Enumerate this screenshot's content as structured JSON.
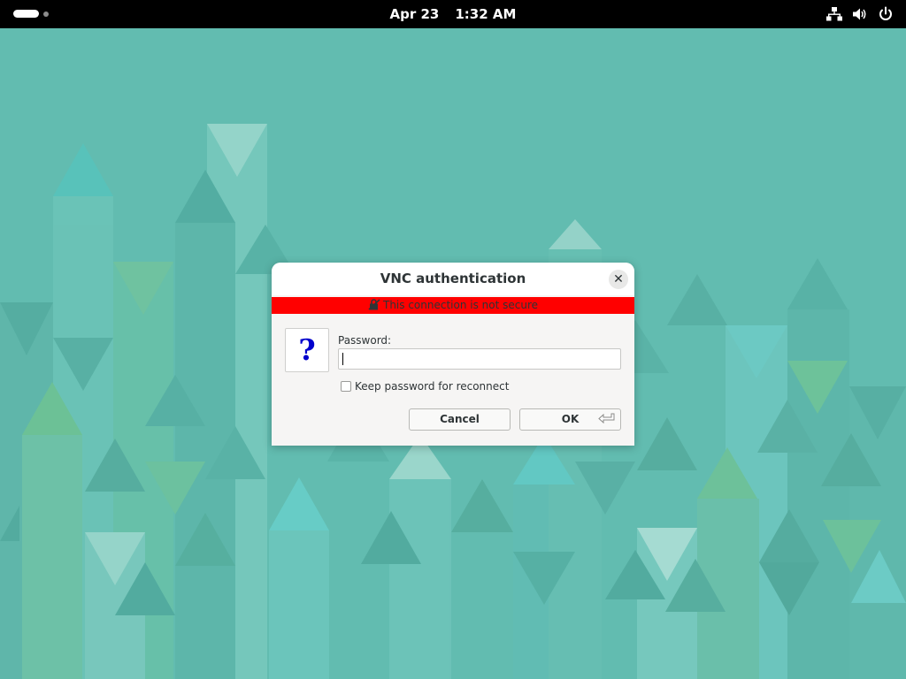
{
  "topbar": {
    "date": "Apr 23",
    "time": "1:32 AM",
    "icons": [
      "network-icon",
      "volume-icon",
      "power-icon"
    ]
  },
  "dialog": {
    "title": "VNC authentication",
    "close_label": "✕",
    "warning_text": "This connection is not secure",
    "question_glyph": "?",
    "password_label": "Password:",
    "password_value": "",
    "keep_password_label": "Keep password for reconnect",
    "keep_password_checked": false,
    "cancel_label": "Cancel",
    "ok_label": "OK"
  },
  "colors": {
    "wallpaper_base": "#62bcb0",
    "warning": "#ff0000",
    "question": "#0000cc"
  }
}
